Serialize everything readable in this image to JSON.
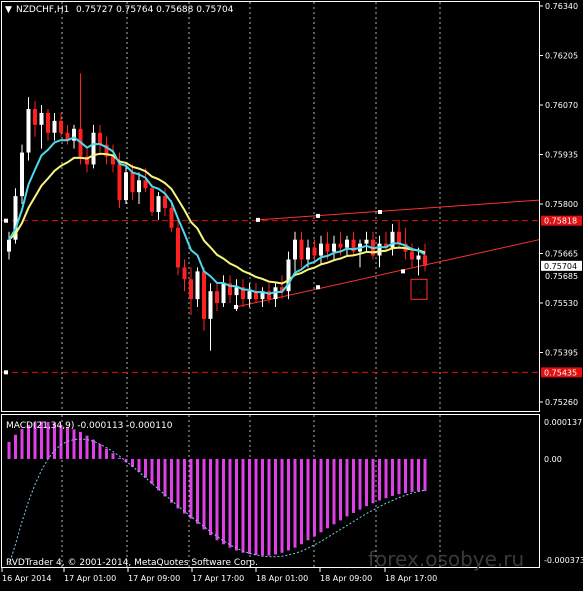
{
  "chart_header": {
    "symbol_tf": "NZDCHF,H1",
    "ohlc": "0.75727 0.75764 0.75688 0.75704"
  },
  "macd_header": {
    "label": "MACD(21,34,9) -0.000113 -0.000110"
  },
  "copyright": "RVDTrader 4, © 2001-2014, MetaQuotes Software Corp.",
  "watermark": "forex.osobye.ru",
  "colors": {
    "bull": "#ffffff",
    "bear": "#ff2020",
    "ma_fast": "#4ed8ec",
    "ma_slow": "#f7f57a",
    "macd_hist": "#e040e8",
    "signal": "#7ad0e8",
    "level_line": "#e01010",
    "channel": "#ff3030",
    "grid": "#ffffff"
  },
  "price_axis": {
    "labels": [
      "0.76340",
      "0.76205",
      "0.76070",
      "0.75935",
      "0.75800",
      "0.75665",
      "0.75530",
      "0.75395",
      "0.75260"
    ],
    "current_price": "0.75704",
    "current_price_bar": "0.75685",
    "level_high": "0.75818",
    "level_low": "0.75435",
    "ylim": [
      0.7534,
      0.7636
    ]
  },
  "macd_axis": {
    "top": "0.000137",
    "zero": "0.00",
    "bottom": "-0.000373"
  },
  "time_axis": {
    "labels": [
      "16 Apr 2014",
      "17 Apr 01:00",
      "17 Apr 09:00",
      "17 Apr 17:00",
      "18 Apr 01:00",
      "18 Apr 09:00",
      "18 Apr 17:00"
    ]
  },
  "chart_data": {
    "type": "candlestick",
    "timeframe": "H1",
    "symbol": "NZDCHF",
    "candles": [
      {
        "o": 0.7574,
        "h": 0.7579,
        "l": 0.7572,
        "c": 0.7577
      },
      {
        "o": 0.7577,
        "h": 0.759,
        "l": 0.7576,
        "c": 0.7588
      },
      {
        "o": 0.7588,
        "h": 0.7601,
        "l": 0.7586,
        "c": 0.7599
      },
      {
        "o": 0.7599,
        "h": 0.7613,
        "l": 0.7597,
        "c": 0.761
      },
      {
        "o": 0.761,
        "h": 0.7612,
        "l": 0.7603,
        "c": 0.7606
      },
      {
        "o": 0.7606,
        "h": 0.7611,
        "l": 0.76,
        "c": 0.7609
      },
      {
        "o": 0.7609,
        "h": 0.761,
        "l": 0.7602,
        "c": 0.7604
      },
      {
        "o": 0.7604,
        "h": 0.7609,
        "l": 0.7602,
        "c": 0.7607
      },
      {
        "o": 0.7607,
        "h": 0.7609,
        "l": 0.7603,
        "c": 0.7604
      },
      {
        "o": 0.7604,
        "h": 0.7606,
        "l": 0.7601,
        "c": 0.7602
      },
      {
        "o": 0.7602,
        "h": 0.7606,
        "l": 0.76,
        "c": 0.7605
      },
      {
        "o": 0.7605,
        "h": 0.7619,
        "l": 0.7596,
        "c": 0.7598
      },
      {
        "o": 0.7598,
        "h": 0.76,
        "l": 0.7594,
        "c": 0.7596
      },
      {
        "o": 0.7596,
        "h": 0.7606,
        "l": 0.7595,
        "c": 0.7604
      },
      {
        "o": 0.7604,
        "h": 0.7606,
        "l": 0.7599,
        "c": 0.7601
      },
      {
        "o": 0.7601,
        "h": 0.7603,
        "l": 0.7596,
        "c": 0.7598
      },
      {
        "o": 0.7598,
        "h": 0.7601,
        "l": 0.7594,
        "c": 0.7596
      },
      {
        "o": 0.7596,
        "h": 0.7599,
        "l": 0.7585,
        "c": 0.7587
      },
      {
        "o": 0.7587,
        "h": 0.7596,
        "l": 0.7586,
        "c": 0.7594
      },
      {
        "o": 0.7594,
        "h": 0.7596,
        "l": 0.7587,
        "c": 0.7589
      },
      {
        "o": 0.7589,
        "h": 0.7594,
        "l": 0.7586,
        "c": 0.7592
      },
      {
        "o": 0.7592,
        "h": 0.7595,
        "l": 0.7589,
        "c": 0.759
      },
      {
        "o": 0.759,
        "h": 0.7591,
        "l": 0.7583,
        "c": 0.7584
      },
      {
        "o": 0.7584,
        "h": 0.7589,
        "l": 0.7582,
        "c": 0.7588
      },
      {
        "o": 0.7588,
        "h": 0.759,
        "l": 0.7583,
        "c": 0.7585
      },
      {
        "o": 0.7585,
        "h": 0.7587,
        "l": 0.7579,
        "c": 0.758
      },
      {
        "o": 0.758,
        "h": 0.7582,
        "l": 0.7568,
        "c": 0.757
      },
      {
        "o": 0.757,
        "h": 0.7572,
        "l": 0.7564,
        "c": 0.7567
      },
      {
        "o": 0.7567,
        "h": 0.757,
        "l": 0.7558,
        "c": 0.7562
      },
      {
        "o": 0.7562,
        "h": 0.757,
        "l": 0.756,
        "c": 0.7569
      },
      {
        "o": 0.7569,
        "h": 0.757,
        "l": 0.7554,
        "c": 0.7557
      },
      {
        "o": 0.7557,
        "h": 0.7566,
        "l": 0.7549,
        "c": 0.7564
      },
      {
        "o": 0.7564,
        "h": 0.7566,
        "l": 0.7559,
        "c": 0.7561
      },
      {
        "o": 0.7561,
        "h": 0.7568,
        "l": 0.756,
        "c": 0.7566
      },
      {
        "o": 0.7566,
        "h": 0.7568,
        "l": 0.7561,
        "c": 0.7563
      },
      {
        "o": 0.7563,
        "h": 0.7567,
        "l": 0.7559,
        "c": 0.7565
      },
      {
        "o": 0.7565,
        "h": 0.7567,
        "l": 0.756,
        "c": 0.7562
      },
      {
        "o": 0.7562,
        "h": 0.7566,
        "l": 0.756,
        "c": 0.7564
      },
      {
        "o": 0.7564,
        "h": 0.7566,
        "l": 0.7561,
        "c": 0.7562
      },
      {
        "o": 0.7562,
        "h": 0.7565,
        "l": 0.756,
        "c": 0.7564
      },
      {
        "o": 0.7564,
        "h": 0.7566,
        "l": 0.7561,
        "c": 0.7562
      },
      {
        "o": 0.7562,
        "h": 0.7566,
        "l": 0.756,
        "c": 0.7565
      },
      {
        "o": 0.7565,
        "h": 0.7568,
        "l": 0.7562,
        "c": 0.7564
      },
      {
        "o": 0.7564,
        "h": 0.7574,
        "l": 0.7562,
        "c": 0.7572
      },
      {
        "o": 0.7572,
        "h": 0.7579,
        "l": 0.7569,
        "c": 0.7577
      },
      {
        "o": 0.7577,
        "h": 0.7579,
        "l": 0.757,
        "c": 0.7572
      },
      {
        "o": 0.7572,
        "h": 0.7577,
        "l": 0.757,
        "c": 0.7575
      },
      {
        "o": 0.7575,
        "h": 0.7577,
        "l": 0.7571,
        "c": 0.7573
      },
      {
        "o": 0.7573,
        "h": 0.7578,
        "l": 0.7571,
        "c": 0.7576
      },
      {
        "o": 0.7576,
        "h": 0.7579,
        "l": 0.7572,
        "c": 0.7574
      },
      {
        "o": 0.7574,
        "h": 0.7578,
        "l": 0.7572,
        "c": 0.7576
      },
      {
        "o": 0.7576,
        "h": 0.7579,
        "l": 0.7573,
        "c": 0.7575
      },
      {
        "o": 0.7575,
        "h": 0.7578,
        "l": 0.7573,
        "c": 0.7577
      },
      {
        "o": 0.7577,
        "h": 0.7579,
        "l": 0.7573,
        "c": 0.7574
      },
      {
        "o": 0.7574,
        "h": 0.7577,
        "l": 0.757,
        "c": 0.7576
      },
      {
        "o": 0.7576,
        "h": 0.7579,
        "l": 0.7574,
        "c": 0.7577
      },
      {
        "o": 0.7577,
        "h": 0.7579,
        "l": 0.7572,
        "c": 0.7573
      },
      {
        "o": 0.7573,
        "h": 0.7578,
        "l": 0.757,
        "c": 0.7576
      },
      {
        "o": 0.7576,
        "h": 0.7579,
        "l": 0.7574,
        "c": 0.7575
      },
      {
        "o": 0.7575,
        "h": 0.7581,
        "l": 0.7573,
        "c": 0.7579
      },
      {
        "o": 0.7579,
        "h": 0.7582,
        "l": 0.7575,
        "c": 0.7576
      },
      {
        "o": 0.7576,
        "h": 0.758,
        "l": 0.7572,
        "c": 0.7574
      },
      {
        "o": 0.7574,
        "h": 0.7576,
        "l": 0.757,
        "c": 0.7572
      },
      {
        "o": 0.7572,
        "h": 0.7575,
        "l": 0.7568,
        "c": 0.7573
      },
      {
        "o": 0.7573,
        "h": 0.7576,
        "l": 0.7569,
        "c": 0.75704
      }
    ],
    "macd_hist": [
      6e-05,
      8.5e-05,
      0.000105,
      0.00012,
      0.00013,
      0.000132,
      0.00013,
      0.000126,
      0.00012,
      0.000112,
      0.000104,
      9.5e-05,
      8.2e-05,
      6.8e-05,
      5.2e-05,
      3.6e-05,
      2e-05,
      4e-06,
      -1.2e-05,
      -2.8e-05,
      -4.6e-05,
      -6.6e-05,
      -8.8e-05,
      -0.00011,
      -0.000132,
      -0.000154,
      -0.000174,
      -0.000192,
      -0.00021,
      -0.000228,
      -0.000248,
      -0.000268,
      -0.000286,
      -0.0003,
      -0.000312,
      -0.000322,
      -0.00033,
      -0.000334,
      -0.000338,
      -0.00034,
      -0.00034,
      -0.000336,
      -0.00033,
      -0.000322,
      -0.000312,
      -0.0003,
      -0.000286,
      -0.000272,
      -0.000258,
      -0.000244,
      -0.00023,
      -0.000216,
      -0.000202,
      -0.00019,
      -0.000178,
      -0.000166,
      -0.000156,
      -0.000146,
      -0.000138,
      -0.00013,
      -0.000124,
      -0.00012,
      -0.000116,
      -0.000114,
      -0.000113
    ],
    "macd_signal": [
      -0.000373,
      -0.0003,
      -0.00022,
      -0.00015,
      -9e-05,
      -4e-05,
      0.0,
      3e-05,
      5e-05,
      6.2e-05,
      6.8e-05,
      7e-05,
      6.8e-05,
      6.2e-05,
      5.2e-05,
      4e-05,
      2.6e-05,
      1e-05,
      -8e-06,
      -2.6e-05,
      -4.6e-05,
      -6.6e-05,
      -8.6e-05,
      -0.000106,
      -0.000126,
      -0.000146,
      -0.000166,
      -0.000184,
      -0.000202,
      -0.00022,
      -0.000238,
      -0.000256,
      -0.000272,
      -0.000288,
      -0.000302,
      -0.000314,
      -0.000324,
      -0.000332,
      -0.000338,
      -0.000342,
      -0.000344,
      -0.000344,
      -0.000342,
      -0.000338,
      -0.000332,
      -0.000324,
      -0.000314,
      -0.000302,
      -0.00029,
      -0.000276,
      -0.000262,
      -0.000248,
      -0.000234,
      -0.00022,
      -0.000206,
      -0.000192,
      -0.00018,
      -0.000168,
      -0.000156,
      -0.000146,
      -0.000136,
      -0.000128,
      -0.00012,
      -0.000114,
      -0.00011
    ],
    "macd_ylim": [
      -0.000373,
      0.000137
    ]
  }
}
